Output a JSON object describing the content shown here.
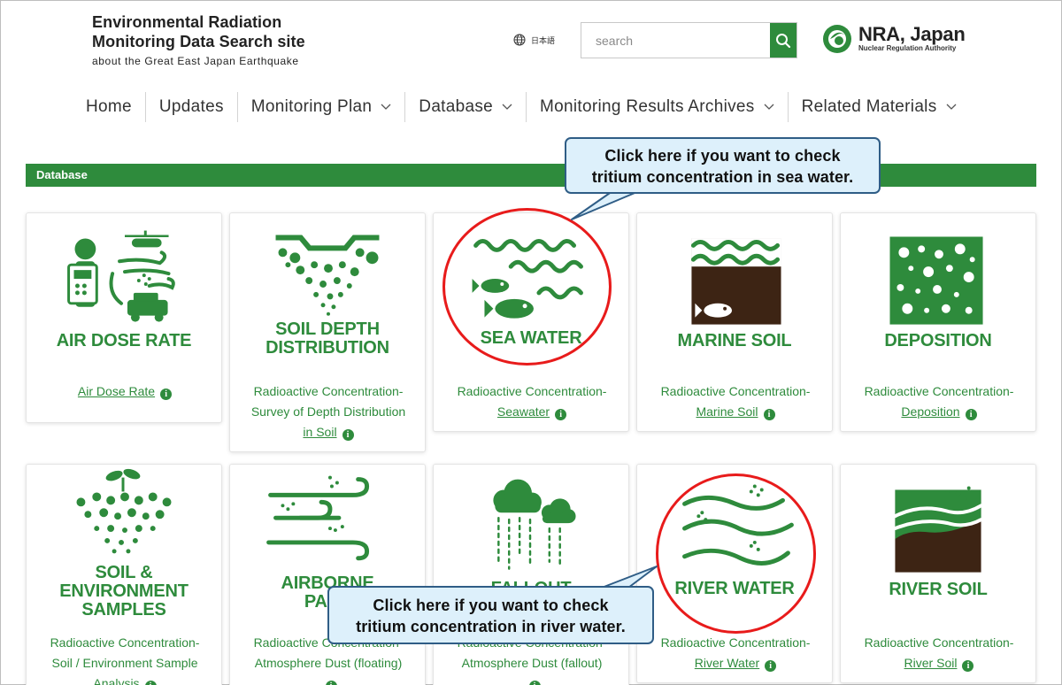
{
  "header": {
    "site_title_line1": "Environmental Radiation",
    "site_title_line2": "Monitoring Data Search site",
    "site_subtitle": "about the Great East Japan Earthquake",
    "language_label": "日本語",
    "search": {
      "placeholder": "search"
    },
    "org_name": "NRA, Japan",
    "org_subtitle": "Nuclear Regulation Authority"
  },
  "nav": {
    "items": [
      {
        "label": "Home",
        "has_dropdown": false
      },
      {
        "label": "Updates",
        "has_dropdown": false
      },
      {
        "label": "Monitoring Plan",
        "has_dropdown": true
      },
      {
        "label": "Database",
        "has_dropdown": true
      },
      {
        "label": "Monitoring Results Archives",
        "has_dropdown": true
      },
      {
        "label": "Related Materials",
        "has_dropdown": true
      }
    ]
  },
  "section": {
    "title": "Database"
  },
  "cards": [
    {
      "icon": "air-dose-rate-icon",
      "title": [
        "AIR DOSE RATE"
      ],
      "link_lines": [
        "Air Dose Rate"
      ]
    },
    {
      "icon": "soil-depth-icon",
      "title": [
        "SOIL DEPTH",
        "DISTRIBUTION"
      ],
      "link_lines": [
        "Radioactive Concentration-",
        "Survey of Depth Distribution",
        "in Soil"
      ]
    },
    {
      "icon": "sea-water-icon",
      "title": [
        "SEA WATER"
      ],
      "link_lines": [
        "Radioactive Concentration-",
        "Seawater"
      ]
    },
    {
      "icon": "marine-soil-icon",
      "title": [
        "MARINE SOIL"
      ],
      "link_lines": [
        "Radioactive Concentration-",
        "Marine Soil"
      ]
    },
    {
      "icon": "deposition-icon",
      "title": [
        "DEPOSITION"
      ],
      "link_lines": [
        "Radioactive Concentration-",
        "Deposition"
      ]
    },
    {
      "icon": "soil-environment-icon",
      "title": [
        "SOIL &",
        "ENVIRONMENT",
        "SAMPLES"
      ],
      "link_lines": [
        "Radioactive Concentration-",
        "Soil / Environment Sample",
        "Analysis"
      ]
    },
    {
      "icon": "airborne-icon",
      "title": [
        "AIRBORNE",
        "PART"
      ],
      "link_lines": [
        "Radioactive Concentration-",
        "Atmosphere Dust (floating)"
      ]
    },
    {
      "icon": "fallout-icon",
      "title": [
        "FALLOUT"
      ],
      "link_lines": [
        "Radioactive Concentration-",
        "Atmosphere Dust (fallout)"
      ]
    },
    {
      "icon": "river-water-icon",
      "title": [
        "RIVER WATER"
      ],
      "link_lines": [
        "Radioactive Concentration-",
        "River Water"
      ]
    },
    {
      "icon": "river-soil-icon",
      "title": [
        "RIVER SOIL"
      ],
      "link_lines": [
        "Radioactive Concentration-",
        "River Soil"
      ]
    }
  ],
  "callouts": {
    "sea": [
      "Click here if you want to check",
      "tritium concentration in sea water."
    ],
    "river": [
      "Click here if you want to check",
      "tritium concentration in river water."
    ]
  },
  "colors": {
    "brand_green": "#2e8b3c",
    "soil_brown": "#3d2414",
    "highlight_red": "#e81b1b",
    "callout_fill": "#ddf0fb",
    "callout_border": "#2f5d86"
  }
}
